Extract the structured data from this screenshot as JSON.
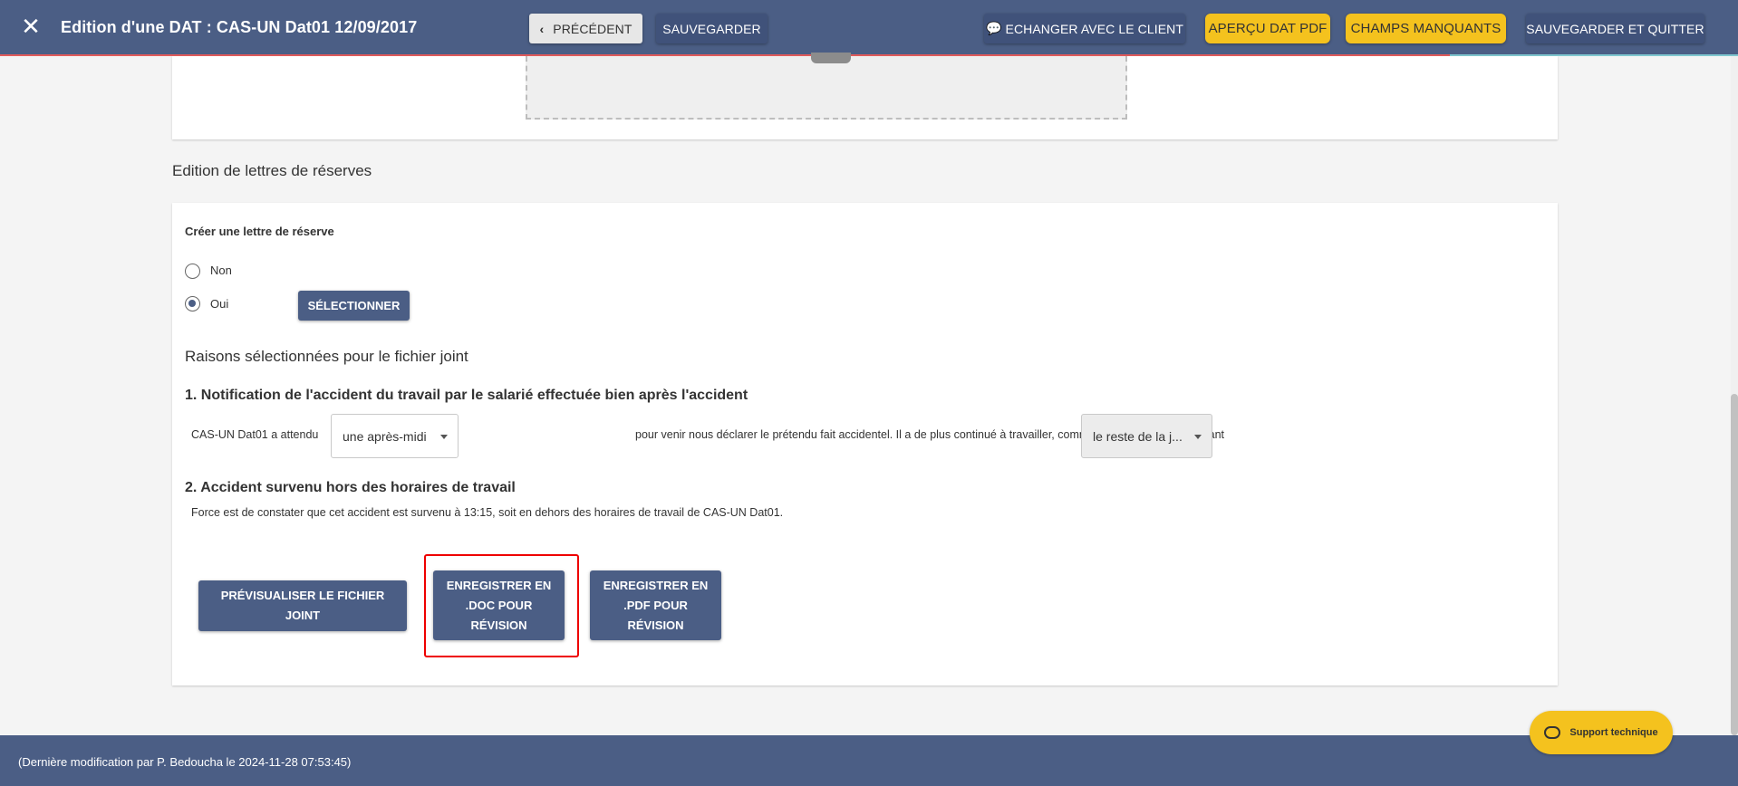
{
  "header": {
    "title": "Edition d'une DAT : CAS-UN Dat01 12/09/2017",
    "previous_label": "PRÉCÉDENT",
    "save_label": "SAUVEGARDER",
    "chat_label": "ECHANGER AVEC LE CLIENT",
    "preview_pdf_label": "APERÇU DAT PDF",
    "missing_fields_label": "CHAMPS MANQUANTS",
    "save_quit_label": "SAUVEGARDER ET QUITTER"
  },
  "section": {
    "title": "Edition de lettres de réserves"
  },
  "form": {
    "create_label": "Créer une lettre de réserve",
    "options": [
      "Non",
      "Oui"
    ],
    "selected_option": "Oui",
    "select_button": "SÉLECTIONNER",
    "reasons_title": "Raisons sélectionnées pour le fichier joint",
    "reason1": {
      "title": "1. Notification de l'accident du travail par le salarié effectuée bien après l'accident",
      "text_before": "CAS-UN Dat01 a attendu",
      "select1_value": "une après-midi",
      "text_middle": "pour venir nous déclarer le prétendu fait accidentel. Il a de plus continué à travailler, comme si de rien n'était, pendant",
      "select2_value": "le reste de la j..."
    },
    "reason2": {
      "title": "2. Accident survenu hors des horaires de travail",
      "text": "Force est de constater que cet accident est survenu à 13:15, soit en dehors des horaires de travail de CAS-UN Dat01."
    },
    "buttons": {
      "preview": "PRÉVISUALISER LE FICHIER JOINT",
      "save_doc": "ENREGISTRER EN .DOC POUR RÉVISION",
      "save_pdf": "ENREGISTRER EN .PDF POUR RÉVISION"
    }
  },
  "footer": {
    "last_modified": "(Dernière modification par P. Bedoucha le 2024-11-28 07:53:45)"
  },
  "support": {
    "label": "Support technique"
  },
  "colors": {
    "primary": "#4b5e85",
    "accent": "#f4c21e",
    "highlight": "#ee0000"
  }
}
